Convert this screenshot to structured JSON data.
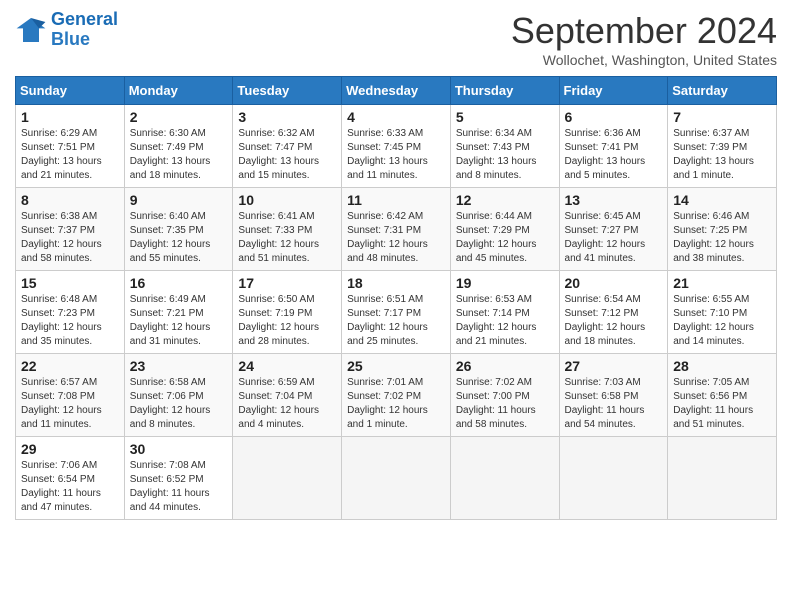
{
  "header": {
    "logo_line1": "General",
    "logo_line2": "Blue",
    "month_year": "September 2024",
    "location": "Wollochet, Washington, United States"
  },
  "days_of_week": [
    "Sunday",
    "Monday",
    "Tuesday",
    "Wednesday",
    "Thursday",
    "Friday",
    "Saturday"
  ],
  "weeks": [
    [
      {
        "day": "1",
        "text": "Sunrise: 6:29 AM\nSunset: 7:51 PM\nDaylight: 13 hours\nand 21 minutes."
      },
      {
        "day": "2",
        "text": "Sunrise: 6:30 AM\nSunset: 7:49 PM\nDaylight: 13 hours\nand 18 minutes."
      },
      {
        "day": "3",
        "text": "Sunrise: 6:32 AM\nSunset: 7:47 PM\nDaylight: 13 hours\nand 15 minutes."
      },
      {
        "day": "4",
        "text": "Sunrise: 6:33 AM\nSunset: 7:45 PM\nDaylight: 13 hours\nand 11 minutes."
      },
      {
        "day": "5",
        "text": "Sunrise: 6:34 AM\nSunset: 7:43 PM\nDaylight: 13 hours\nand 8 minutes."
      },
      {
        "day": "6",
        "text": "Sunrise: 6:36 AM\nSunset: 7:41 PM\nDaylight: 13 hours\nand 5 minutes."
      },
      {
        "day": "7",
        "text": "Sunrise: 6:37 AM\nSunset: 7:39 PM\nDaylight: 13 hours\nand 1 minute."
      }
    ],
    [
      {
        "day": "8",
        "text": "Sunrise: 6:38 AM\nSunset: 7:37 PM\nDaylight: 12 hours\nand 58 minutes."
      },
      {
        "day": "9",
        "text": "Sunrise: 6:40 AM\nSunset: 7:35 PM\nDaylight: 12 hours\nand 55 minutes."
      },
      {
        "day": "10",
        "text": "Sunrise: 6:41 AM\nSunset: 7:33 PM\nDaylight: 12 hours\nand 51 minutes."
      },
      {
        "day": "11",
        "text": "Sunrise: 6:42 AM\nSunset: 7:31 PM\nDaylight: 12 hours\nand 48 minutes."
      },
      {
        "day": "12",
        "text": "Sunrise: 6:44 AM\nSunset: 7:29 PM\nDaylight: 12 hours\nand 45 minutes."
      },
      {
        "day": "13",
        "text": "Sunrise: 6:45 AM\nSunset: 7:27 PM\nDaylight: 12 hours\nand 41 minutes."
      },
      {
        "day": "14",
        "text": "Sunrise: 6:46 AM\nSunset: 7:25 PM\nDaylight: 12 hours\nand 38 minutes."
      }
    ],
    [
      {
        "day": "15",
        "text": "Sunrise: 6:48 AM\nSunset: 7:23 PM\nDaylight: 12 hours\nand 35 minutes."
      },
      {
        "day": "16",
        "text": "Sunrise: 6:49 AM\nSunset: 7:21 PM\nDaylight: 12 hours\nand 31 minutes."
      },
      {
        "day": "17",
        "text": "Sunrise: 6:50 AM\nSunset: 7:19 PM\nDaylight: 12 hours\nand 28 minutes."
      },
      {
        "day": "18",
        "text": "Sunrise: 6:51 AM\nSunset: 7:17 PM\nDaylight: 12 hours\nand 25 minutes."
      },
      {
        "day": "19",
        "text": "Sunrise: 6:53 AM\nSunset: 7:14 PM\nDaylight: 12 hours\nand 21 minutes."
      },
      {
        "day": "20",
        "text": "Sunrise: 6:54 AM\nSunset: 7:12 PM\nDaylight: 12 hours\nand 18 minutes."
      },
      {
        "day": "21",
        "text": "Sunrise: 6:55 AM\nSunset: 7:10 PM\nDaylight: 12 hours\nand 14 minutes."
      }
    ],
    [
      {
        "day": "22",
        "text": "Sunrise: 6:57 AM\nSunset: 7:08 PM\nDaylight: 12 hours\nand 11 minutes."
      },
      {
        "day": "23",
        "text": "Sunrise: 6:58 AM\nSunset: 7:06 PM\nDaylight: 12 hours\nand 8 minutes."
      },
      {
        "day": "24",
        "text": "Sunrise: 6:59 AM\nSunset: 7:04 PM\nDaylight: 12 hours\nand 4 minutes."
      },
      {
        "day": "25",
        "text": "Sunrise: 7:01 AM\nSunset: 7:02 PM\nDaylight: 12 hours\nand 1 minute."
      },
      {
        "day": "26",
        "text": "Sunrise: 7:02 AM\nSunset: 7:00 PM\nDaylight: 11 hours\nand 58 minutes."
      },
      {
        "day": "27",
        "text": "Sunrise: 7:03 AM\nSunset: 6:58 PM\nDaylight: 11 hours\nand 54 minutes."
      },
      {
        "day": "28",
        "text": "Sunrise: 7:05 AM\nSunset: 6:56 PM\nDaylight: 11 hours\nand 51 minutes."
      }
    ],
    [
      {
        "day": "29",
        "text": "Sunrise: 7:06 AM\nSunset: 6:54 PM\nDaylight: 11 hours\nand 47 minutes."
      },
      {
        "day": "30",
        "text": "Sunrise: 7:08 AM\nSunset: 6:52 PM\nDaylight: 11 hours\nand 44 minutes."
      },
      {
        "day": "",
        "text": ""
      },
      {
        "day": "",
        "text": ""
      },
      {
        "day": "",
        "text": ""
      },
      {
        "day": "",
        "text": ""
      },
      {
        "day": "",
        "text": ""
      }
    ]
  ]
}
